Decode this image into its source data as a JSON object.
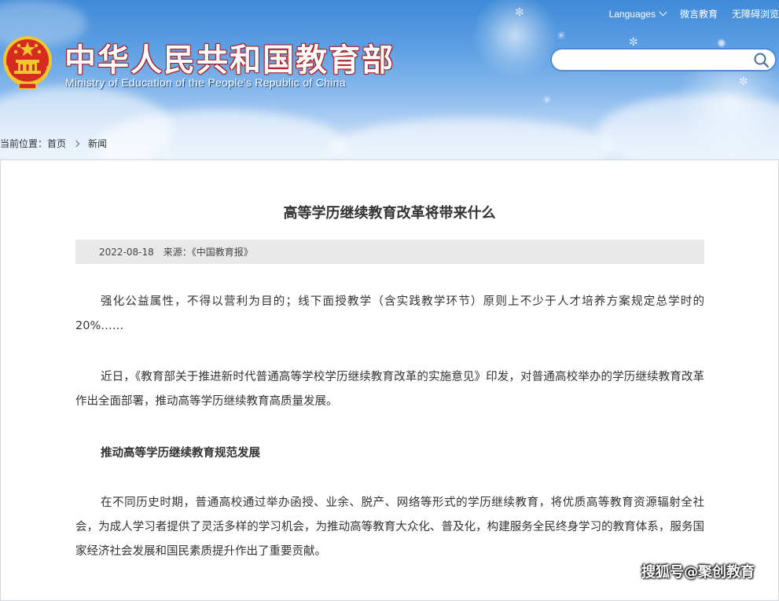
{
  "header": {
    "title": "中华人民共和国教育部",
    "subtitle": "Ministry of Education of the People's Republic of China",
    "top_links": {
      "languages": "Languages",
      "weiyan": "微言教育",
      "accessible": "无障碍浏览"
    },
    "search": {
      "placeholder": "",
      "value": "",
      "icon": "search-icon"
    }
  },
  "breadcrumb": {
    "label": "当前位置：",
    "items": [
      "首页",
      "新闻"
    ]
  },
  "article": {
    "title": "高等学历继续教育改革将带来什么",
    "date": "2022-08-18",
    "source": "来源：《中国教育报》",
    "paragraphs": [
      "强化公益属性，不得以营利为目的；线下面授教学（含实践教学环节）原则上不少于人才培养方案规定总学时的20%……",
      "近日，《教育部关于推进新时代普通高等学校学历继续教育改革的实施意见》印发，对普通高校举办的学历继续教育改革作出全面部署，推动高等学历继续教育高质量发展。",
      "在不同历史时期，普通高校通过举办函授、业余、脱产、网络等形式的学历继续教育，将优质高等教育资源辐射全社会，为成人学习者提供了灵活多样的学习机会，为推动高等教育大众化、普及化，构建服务全民终身学习的教育体系，服务国家经济社会发展和国民素质提升作出了重要贡献。"
    ],
    "subheading": "推动高等学历继续教育规范发展"
  },
  "watermark": "搜狐号@聚创教育",
  "colors": {
    "header_top": "#3f8ad8",
    "header_bottom": "#d8e8f8",
    "title_outline": "#b21f1f",
    "meta_bg": "#e9e9e9",
    "frame_border": "#cfd6de",
    "search_border": "#4a8fd6",
    "emblem_red": "#d62b20",
    "emblem_gold": "#f2c531"
  }
}
